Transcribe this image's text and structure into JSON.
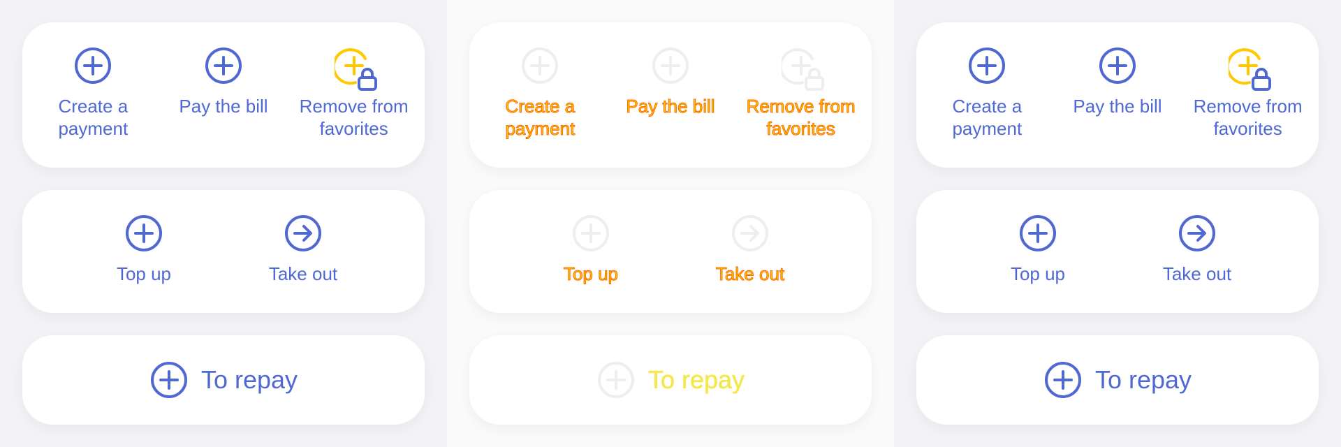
{
  "colors": {
    "accent": "#5068d2",
    "highlight": "#ffc800",
    "disabled_icon": "#eeeeee",
    "debug_text_fill": "#f5cc00",
    "debug_text_stroke": "#ff6a00"
  },
  "panels": [
    {
      "state": "normal",
      "actions_row1": [
        {
          "label": "Create a\npayment",
          "icon": "plus-circle-icon"
        },
        {
          "label": "Pay the bill",
          "icon": "plus-circle-icon"
        },
        {
          "label": "Remove from\nfavorites",
          "icon": "plus-circle-lock-icon"
        }
      ],
      "actions_row2": [
        {
          "label": "Top up",
          "icon": "plus-circle-icon"
        },
        {
          "label": "Take out",
          "icon": "arrow-right-circle-icon"
        }
      ],
      "repay": {
        "label": "To repay",
        "icon": "plus-circle-icon"
      }
    },
    {
      "state": "disabled",
      "actions_row1": [
        {
          "label": "Create a\npayment",
          "icon": "plus-circle-icon"
        },
        {
          "label": "Pay the bill",
          "icon": "plus-circle-icon"
        },
        {
          "label": "Remove from\nfavorites",
          "icon": "plus-circle-lock-icon"
        }
      ],
      "actions_row2": [
        {
          "label": "Top up",
          "icon": "plus-circle-icon"
        },
        {
          "label": "Take out",
          "icon": "arrow-right-circle-icon"
        }
      ],
      "repay": {
        "label": "To repay",
        "icon": "plus-circle-icon"
      }
    },
    {
      "state": "normal",
      "actions_row1": [
        {
          "label": "Create a\npayment",
          "icon": "plus-circle-icon"
        },
        {
          "label": "Pay the bill",
          "icon": "plus-circle-icon"
        },
        {
          "label": "Remove from\nfavorites",
          "icon": "plus-circle-lock-icon"
        }
      ],
      "actions_row2": [
        {
          "label": "Top up",
          "icon": "plus-circle-icon"
        },
        {
          "label": "Take out",
          "icon": "arrow-right-circle-icon"
        }
      ],
      "repay": {
        "label": "To repay",
        "icon": "plus-circle-icon"
      }
    }
  ]
}
